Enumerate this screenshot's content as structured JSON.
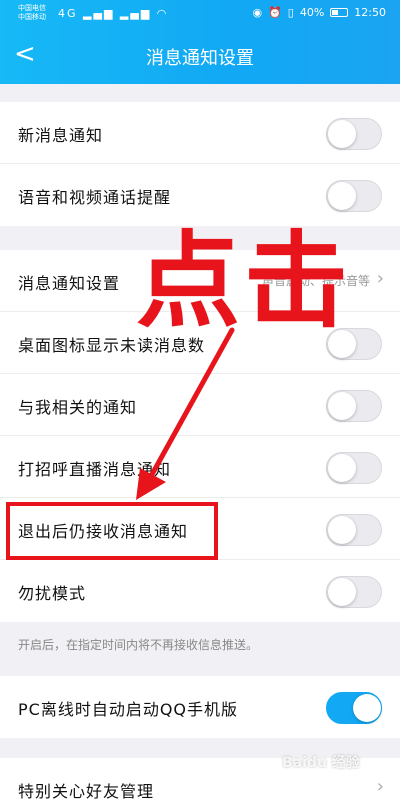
{
  "status_bar": {
    "carrier_1": "中国电信",
    "carrier_2": "中国移动",
    "signal_icons": "4G ▂▄▆ ▂▄▆ ◠",
    "battery_pct": "40%",
    "time": "12:50"
  },
  "header": {
    "title": "消息通知设置"
  },
  "section1": {
    "items": [
      {
        "label": "新消息通知",
        "on": false
      },
      {
        "label": "语音和视频通话提醒",
        "on": false
      }
    ]
  },
  "section2": {
    "items": [
      {
        "label": "消息通知设置",
        "value": "声音震动、提示音等"
      },
      {
        "label": "桌面图标显示未读消息数",
        "on": false
      },
      {
        "label": "与我相关的通知",
        "on": false
      },
      {
        "label": "打招呼直播消息通知",
        "on": false
      },
      {
        "label": "退出后仍接收消息通知",
        "on": false
      },
      {
        "label": "勿扰模式",
        "on": false
      }
    ]
  },
  "hint": "开启后，在指定时间内将不再接收信息推送。",
  "section3": {
    "items": [
      {
        "label": "PC离线时自动启动QQ手机版",
        "on": true
      }
    ]
  },
  "section4": {
    "items": [
      {
        "label": "特别关心好友管理"
      }
    ]
  },
  "annotation": {
    "text": "点击"
  },
  "watermark": "Baidu 经验",
  "colors": {
    "accent": "#12a8f4",
    "annotation_red": "#e8141c"
  }
}
